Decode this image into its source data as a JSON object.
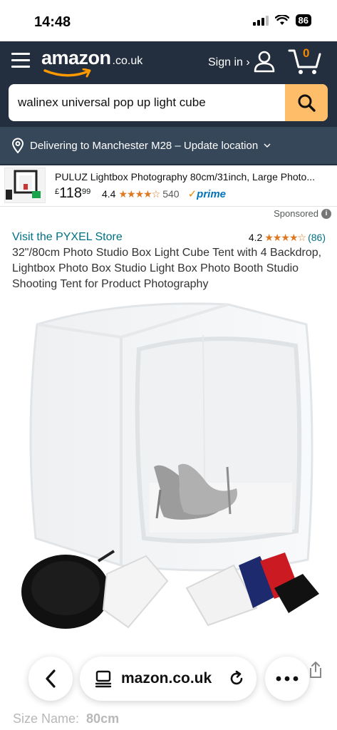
{
  "status_bar": {
    "time": "14:48",
    "battery": "86",
    "icons": [
      "signal-icon",
      "wifi-icon",
      "battery-icon"
    ]
  },
  "header": {
    "logo_main": "amazon",
    "logo_tld": ".co.uk",
    "signin_label": "Sign in ›",
    "cart_count": "0",
    "icons": [
      "hamburger-menu-icon",
      "user-icon",
      "cart-icon"
    ]
  },
  "search": {
    "value": "walinex universal pop up light cube",
    "button_icon": "search-icon"
  },
  "delivery": {
    "text": "Delivering to Manchester M28 – Update location",
    "icons": [
      "location-pin-icon",
      "chevron-down-icon"
    ]
  },
  "promo": {
    "title": "PULUZ Lightbox Photography 80cm/31inch, Large Photo...",
    "price_currency": "£",
    "price_whole": "118",
    "price_fraction": "99",
    "rating": "4.4",
    "stars": "★★★★☆",
    "review_count": "540",
    "prime_label": "prime"
  },
  "listing": {
    "sponsored_label": "Sponsored",
    "store_link": "Visit the PYXEL Store",
    "rating": "4.2",
    "stars": "★★★★☆",
    "review_count": "(86)",
    "title": "32\"/80cm Photo Studio Box Light Cube Tent with 4 Backdrop, Lightbox Photo Box Studio Light Box Photo Booth Studio Shooting Tent for Product Photography"
  },
  "browser": {
    "url": "mazon.co.uk",
    "icons": [
      "back-arrow-icon",
      "reader-icon",
      "reload-icon",
      "more-dots-icon",
      "share-icon"
    ]
  },
  "size": {
    "label": "Size Name:",
    "value": "80cm"
  },
  "colors": {
    "header_bg": "#232f3e",
    "delivery_bg": "#37475a",
    "search_button": "#febd69",
    "link": "#007185",
    "star": "#de7921",
    "cart_accent": "#f08804"
  }
}
